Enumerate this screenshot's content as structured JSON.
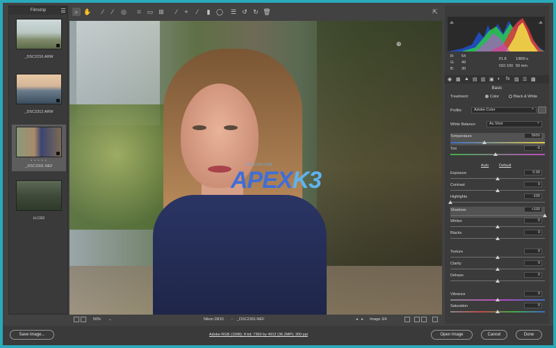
{
  "filmstrip": {
    "title": "Filmstrip",
    "items": [
      {
        "label": "_DSC2216.ARW"
      },
      {
        "label": "_DSC2312.ARW"
      },
      {
        "label": "_DSC2391.NEF",
        "stars": "• • • • •"
      },
      {
        "label": "H.CR2"
      }
    ]
  },
  "toolbar": {
    "tools": [
      "zoom-icon",
      "hand-icon",
      "white-balance-icon",
      "color-sampler-icon",
      "targeted-adjust-icon",
      "crop-icon",
      "straighten-icon",
      "transform-icon",
      "spot-removal-icon",
      "red-eye-icon",
      "adjustment-brush-icon",
      "graduated-filter-icon",
      "radial-filter-icon",
      "preferences-icon",
      "rotate-left-icon",
      "rotate-right-icon",
      "trash-icon"
    ],
    "fullscreen_icon": "fullscreen-icon"
  },
  "photo": {
    "watermark_main": "APEX",
    "watermark_k3": "K3",
    "watermark_small": "EDUCATION"
  },
  "statusbar": {
    "zoom": "50%",
    "camera": "Nikon D810",
    "separator": "-",
    "filename": "_DSC2391.NEF",
    "image_counter": "Image 3/4"
  },
  "histogram": {
    "r_label": "R:",
    "r_value": "54",
    "g_label": "G:",
    "g_value": "49",
    "b_label": "B:",
    "b_value": "30",
    "aperture": "f/1.8",
    "shutter": "1/800 s",
    "iso": "ISO 100",
    "focal": "50 mm"
  },
  "basic": {
    "title": "Basic",
    "treatment_label": "Treatment:",
    "treatment_color": "Color",
    "treatment_bw": "Black & White",
    "profile_label": "Profile:",
    "profile_value": "Adobe Color",
    "wb_label": "White Balance:",
    "wb_value": "As Shot",
    "temperature_label": "Temperature",
    "temperature_value": "5650",
    "tint_label": "Tint",
    "tint_value": "-6",
    "auto_label": "Auto",
    "default_label": "Default",
    "exposure_label": "Exposure",
    "exposure_value": "0.00",
    "contrast_label": "Contrast",
    "contrast_value": "0",
    "highlights_label": "Highlights",
    "highlights_value": "-100",
    "shadows_label": "Shadows",
    "shadows_value": "+100",
    "whites_label": "Whites",
    "whites_value": "0",
    "blacks_label": "Blacks",
    "blacks_value": "0",
    "texture_label": "Texture",
    "texture_value": "0",
    "clarity_label": "Clarity",
    "clarity_value": "0",
    "dehaze_label": "Dehaze",
    "dehaze_value": "0",
    "vibrance_label": "Vibrance",
    "vibrance_value": "0",
    "saturation_label": "Saturation",
    "saturation_value": "0"
  },
  "bottom": {
    "save_label": "Save Image...",
    "workflow_link": "Adobe RGB (1998); 8 bit; 7360 by 4912 (36.2MP); 300 ppi",
    "open_label": "Open Image",
    "cancel_label": "Cancel",
    "done_label": "Done"
  }
}
